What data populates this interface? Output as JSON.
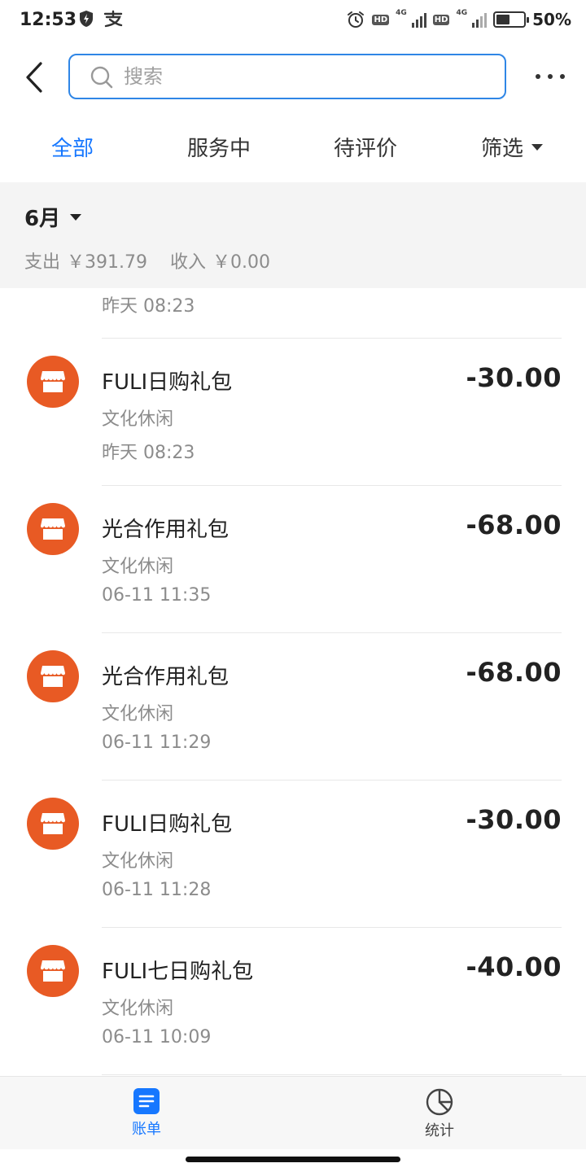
{
  "status_bar": {
    "time": "12:53",
    "battery_percent_text": "50%",
    "battery_level": 0.5,
    "icons": [
      "shield-icon",
      "alipay-icon",
      "alarm-icon",
      "hd-icon",
      "signal-4g-icon",
      "hd-icon",
      "signal-4g-icon",
      "battery-icon"
    ],
    "network_label": "4G",
    "hd_label": "HD"
  },
  "header": {
    "search_placeholder": "搜索",
    "icons": {
      "back": "back-arrow-icon",
      "search": "search-icon",
      "more": "more-dots-icon"
    }
  },
  "tabs": [
    {
      "label": "全部",
      "active": true
    },
    {
      "label": "服务中",
      "active": false
    },
    {
      "label": "待评价",
      "active": false
    },
    {
      "label": "筛选",
      "active": false
    }
  ],
  "month_panel": {
    "month": "6月",
    "expense_label": "支出",
    "expense_value": "￥391.79",
    "income_label": "收入",
    "income_value": "￥0.00"
  },
  "partial_row_time": "昨天  08:23",
  "transactions": [
    {
      "title": "FULI日购礼包",
      "category": "文化休闲",
      "time": "昨天  08:23",
      "amount": "-30.00"
    },
    {
      "title": "光合作用礼包",
      "category": "文化休闲",
      "time": "06-11  11:35",
      "amount": "-68.00"
    },
    {
      "title": "光合作用礼包",
      "category": "文化休闲",
      "time": "06-11  11:29",
      "amount": "-68.00"
    },
    {
      "title": "FULI日购礼包",
      "category": "文化休闲",
      "time": "06-11  11:28",
      "amount": "-30.00"
    },
    {
      "title": "FULI七日购礼包",
      "category": "文化休闲",
      "time": "06-11  10:09",
      "amount": "-40.00"
    }
  ],
  "bottom_nav": [
    {
      "label": "账单",
      "icon": "bill-icon",
      "active": true
    },
    {
      "label": "统计",
      "icon": "pie-chart-icon",
      "active": false
    }
  ],
  "colors": {
    "accent": "#1677ff",
    "merchant_icon_bg": "#e85a24",
    "search_border": "#2f86e6",
    "panel_bg": "#f4f4f4"
  }
}
